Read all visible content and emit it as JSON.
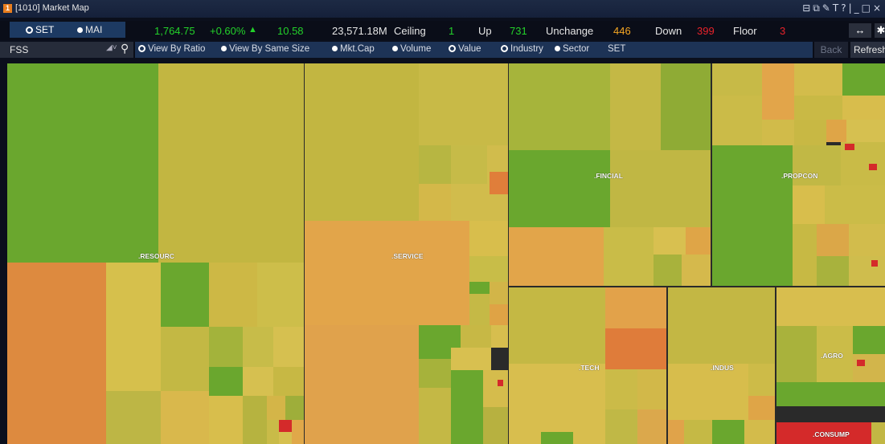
{
  "window": {
    "title": "[1010] Market Map",
    "icon_badge": "1",
    "controls": "⊟⧉✎T?|_□×"
  },
  "market_toggle": [
    {
      "label": "SET",
      "selected": true
    },
    {
      "label": "MAI",
      "selected": false
    }
  ],
  "stats": {
    "index": "1,764.75",
    "change_pct": "+0.60%",
    "change_arrow": "▲",
    "change_pts": "10.58",
    "value": "23,571.18M",
    "ceiling_label": "Ceiling",
    "ceiling": "1",
    "up_label": "Up",
    "up": "731",
    "unchange_label": "Unchange",
    "unchange": "446",
    "down_label": "Down",
    "down": "399",
    "floor_label": "Floor",
    "floor": "3"
  },
  "filter": {
    "symbol": "FSS",
    "search_icon": "search-icon",
    "options": [
      {
        "label": "View By Ratio",
        "style": "ring"
      },
      {
        "label": "View By Same Size",
        "style": "dot"
      },
      {
        "label": "Mkt.Cap",
        "style": "dot"
      },
      {
        "label": "Volume",
        "style": "dot"
      },
      {
        "label": "Value",
        "style": "ring"
      },
      {
        "label": "Industry",
        "style": "ring"
      },
      {
        "label": "Sector",
        "style": "dot"
      }
    ],
    "market": "SET",
    "back_label": "Back",
    "refresh_label": "Refresh"
  },
  "sectors": [
    {
      "label": ".RESOURC"
    },
    {
      "label": ".SERVICE"
    },
    {
      "label": ".FINCIAL"
    },
    {
      "label": ".PROPCON"
    },
    {
      "label": ".TECH"
    },
    {
      "label": ".INDUS"
    },
    {
      "label": ".AGRO"
    },
    {
      "label": ".CONSUMP"
    }
  ],
  "colors": {
    "up_strong": "#6aa72e",
    "up_mild": "#a3b33b",
    "flat": "#d6c250",
    "down_mild": "#e3a94a",
    "down": "#e07e3a",
    "down_strong": "#d42a2a"
  }
}
